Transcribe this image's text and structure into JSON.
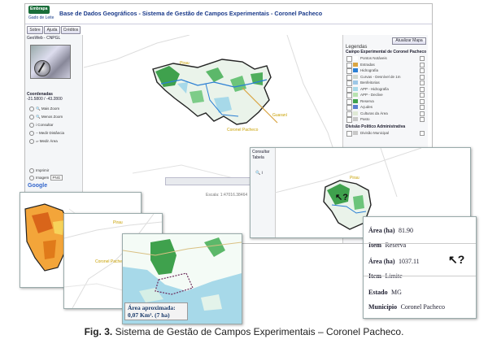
{
  "header": {
    "logo_text": "Embrapa",
    "logo_sub": "Gado de Leite",
    "title": "Base de Dados Geográficos - Sistema de Gestão de Campos Experimentais - Coronel Pacheco"
  },
  "toolbar": {
    "sobre": "Sobre",
    "ajuda": "Ajuda",
    "creditos": "Créditos"
  },
  "overview": {
    "title": "GeoWeb - CNPGL"
  },
  "tools": {
    "coords_label": "Coordenadas",
    "coords_value": "-21.5800 / -43.2800",
    "items": [
      "Mais Zoom",
      "Menos Zoom",
      "Consultar",
      "Medir Distância",
      "Medir Área"
    ],
    "imprimir": "Imprimir",
    "imagem": "Imagem",
    "imagem_format": "PNG",
    "google": "Google"
  },
  "legend": {
    "refresh_button": "Atualizar Mapa",
    "title": "Legendas",
    "group1": "Campo Experimental de Coronel Pacheco",
    "items": [
      "Pontos Notáveis",
      "Estradas",
      "Hidrografia",
      "Curvas - Desnível de 1m",
      "Benfeitorias",
      "APP - Hidrografia",
      "APP - Declive",
      "Reserva",
      "Açudes",
      "Culturas da Área",
      "Pasto"
    ],
    "group2": "Divisão Político Administrativa",
    "item_last": "Divisão Municipal",
    "colors": [
      "#ffffff",
      "#d9a441",
      "#2a7fd4",
      "#cfd8cf",
      "#9cc7e6",
      "#a7d9e9",
      "#b8e3b0",
      "#3fa14d",
      "#5a7fd0",
      "#dfe9d5",
      "#c8c8c8"
    ]
  },
  "main_map": {
    "labels": {
      "pirau": "Pirau",
      "guarani": "Guaraní",
      "coronel_pacheco": "Coronel Pacheco"
    },
    "scale": "Escala: 1:47016.38464"
  },
  "consult_window": {
    "title": "Consultar Tabela",
    "label": "Pirau"
  },
  "info_popup": {
    "area1_label": "Área (ha)",
    "area1_value": "81.90",
    "item1_label": "Item",
    "item1_value": "Reserva",
    "area2_label": "Área (ha)",
    "area2_value": "1037.11",
    "item2_label": "Item",
    "item2_value": "Limite",
    "estado_label": "Estado",
    "estado_value": "MG",
    "municipio_label": "Município",
    "municipio_value": "Coronel Pacheco"
  },
  "area_box": {
    "line1": "Área aproximada:",
    "line2": "0,07 Km². (7 ha)"
  },
  "caption": {
    "fig": "Fig. 3.",
    "text": " Sistema de Gestão de Campos Experimentais – Coronel Pacheco."
  }
}
